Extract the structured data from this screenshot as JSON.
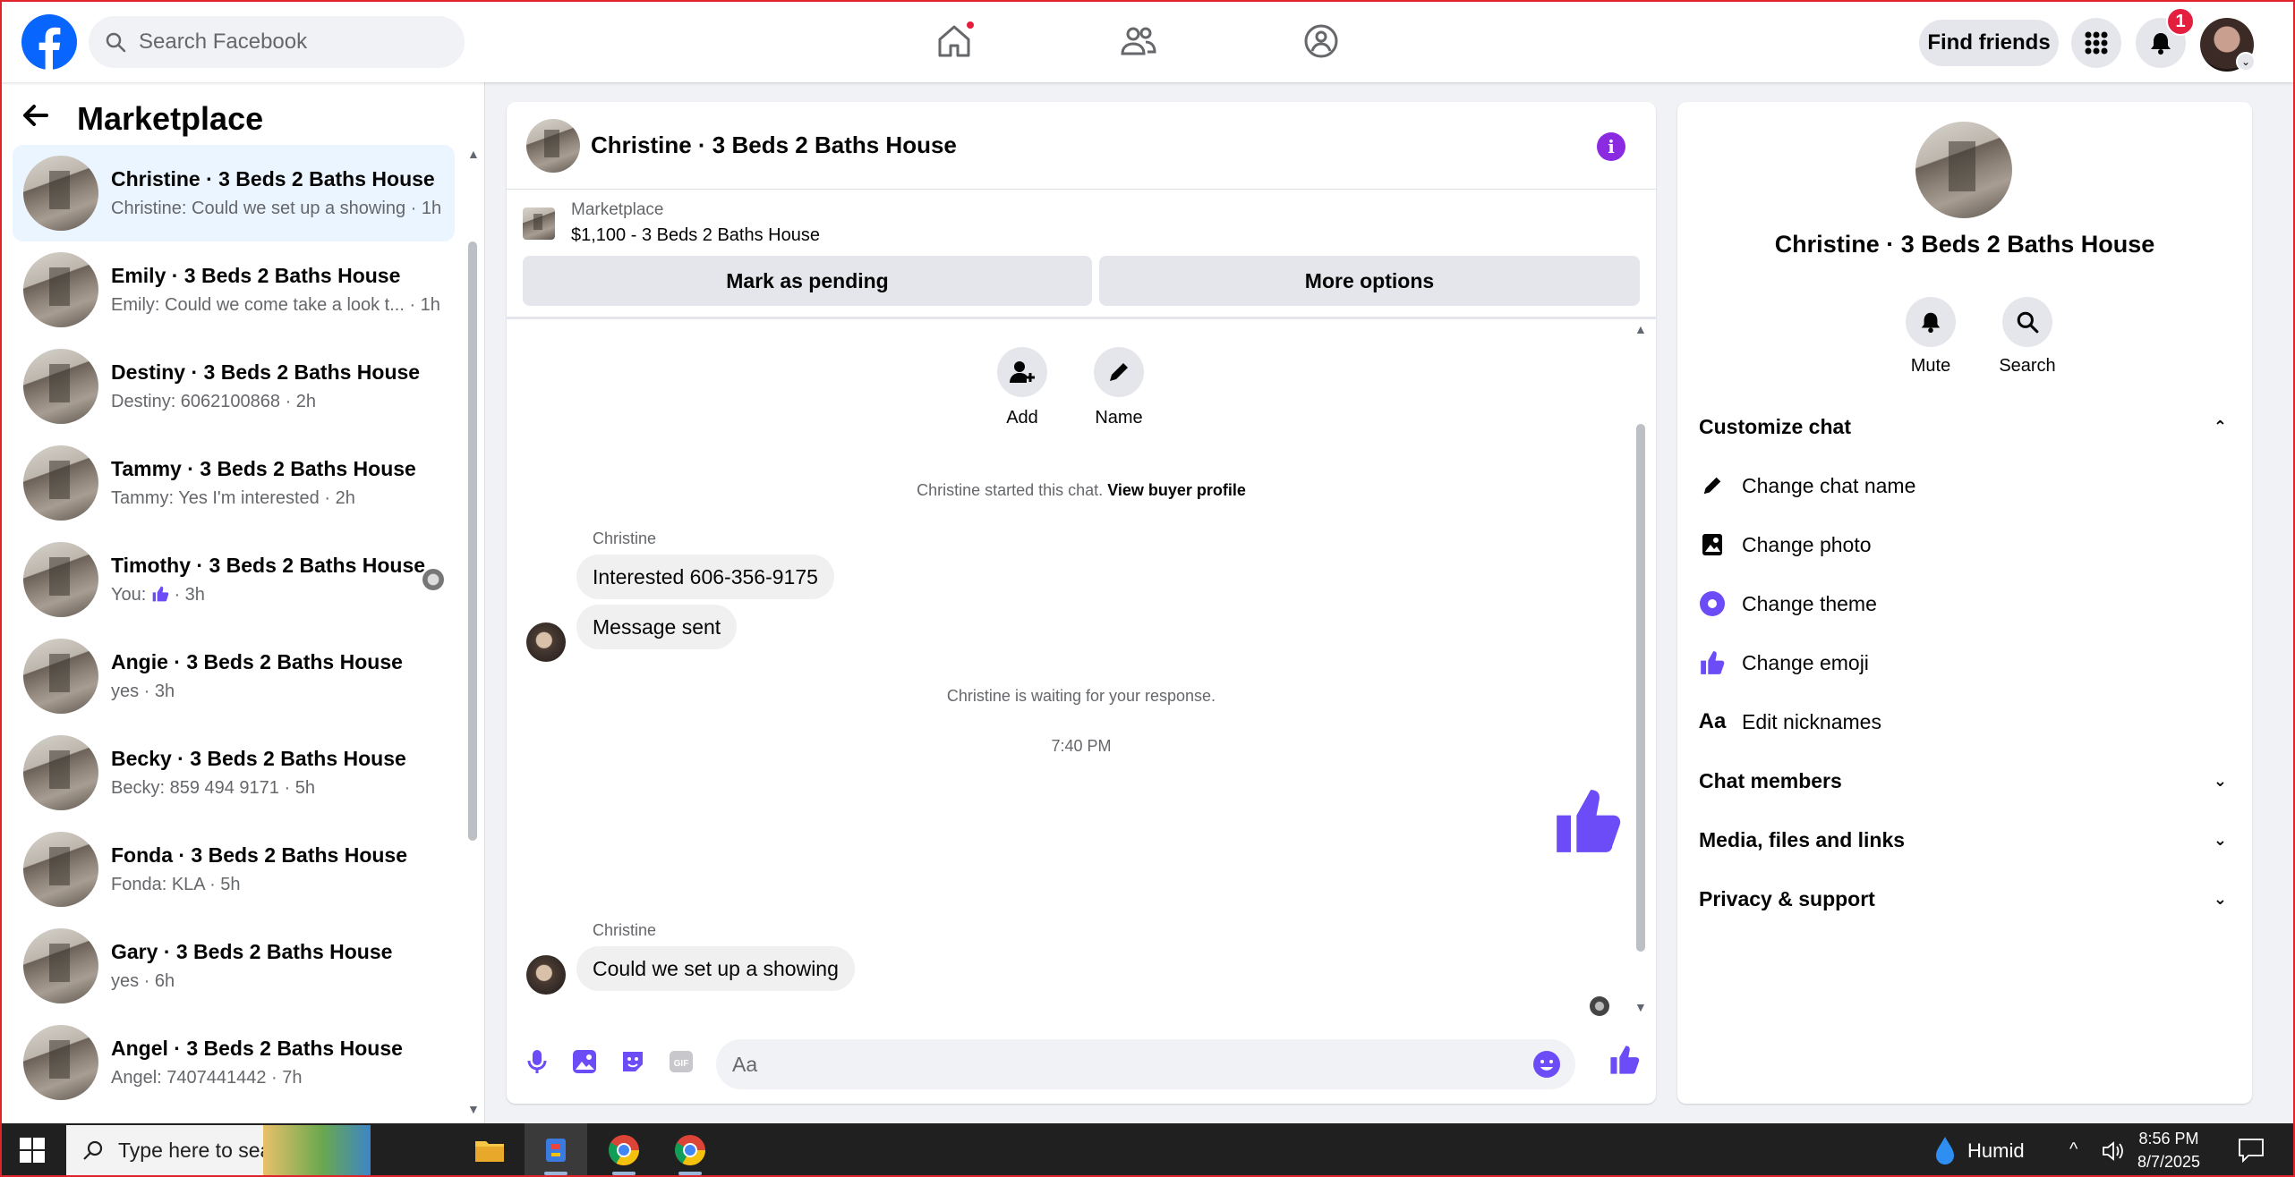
{
  "topbar": {
    "search_placeholder": "Search Facebook",
    "find_friends": "Find friends",
    "notification_count": "1",
    "brand_color": "#0866ff"
  },
  "sidebar": {
    "title": "Marketplace",
    "conversations": [
      {
        "name": "Christine · 3 Beds 2 Baths House",
        "preview": "Christine: Could we set up a showing · 1h",
        "active": true
      },
      {
        "name": "Emily · 3 Beds 2 Baths House",
        "preview": "Emily: Could we come take a look t... · 1h"
      },
      {
        "name": "Destiny · 3 Beds 2 Baths House",
        "preview": "Destiny: 6062100868 · 2h"
      },
      {
        "name": "Tammy · 3 Beds 2 Baths House",
        "preview": "Tammy: Yes I'm interested · 2h"
      },
      {
        "name": "Timothy · 3 Beds 2 Baths House",
        "preview_prefix": "You:",
        "preview_suffix": "· 3h"
      },
      {
        "name": "Angie · 3 Beds 2 Baths House",
        "preview": "yes · 3h"
      },
      {
        "name": "Becky · 3 Beds 2 Baths House",
        "preview": "Becky: 859 494 9171 · 5h"
      },
      {
        "name": "Fonda · 3 Beds 2 Baths House",
        "preview": "Fonda: KLA · 5h"
      },
      {
        "name": "Gary · 3 Beds 2 Baths House",
        "preview": "yes · 6h"
      },
      {
        "name": "Angel · 3 Beds 2 Baths House",
        "preview": "Angel: 7407441442 · 7h"
      }
    ]
  },
  "chat": {
    "title": "Christine · 3 Beds 2 Baths House",
    "listing_source": "Marketplace",
    "listing_title": "$1,100 - 3 Beds 2 Baths House",
    "mark_pending": "Mark as pending",
    "more_options": "More options",
    "add_label": "Add",
    "name_label": "Name",
    "started_text": "Christine started this chat.",
    "view_buyer_profile": "View buyer profile",
    "sender1": "Christine",
    "msg1": "Interested 606-356-9175",
    "msg2": "Message sent",
    "waiting_text": "Christine is waiting for your response.",
    "timestamp": "7:40 PM",
    "sender2": "Christine",
    "msg3": "Could we set up a showing",
    "composer_placeholder": "Aa",
    "accent_color": "#6b4cf6"
  },
  "panel": {
    "name": "Christine · 3 Beds 2 Baths House",
    "mute": "Mute",
    "search": "Search",
    "customize_chat": "Customize chat",
    "change_chat_name": "Change chat name",
    "change_photo": "Change photo",
    "change_theme": "Change theme",
    "change_emoji": "Change emoji",
    "edit_nicknames": "Edit nicknames",
    "chat_members": "Chat members",
    "media_files_links": "Media, files and links",
    "privacy_support": "Privacy & support"
  },
  "taskbar": {
    "search_placeholder": "Type here to search",
    "weather": "Humid",
    "time": "8:56 PM",
    "date": "8/7/2025"
  }
}
